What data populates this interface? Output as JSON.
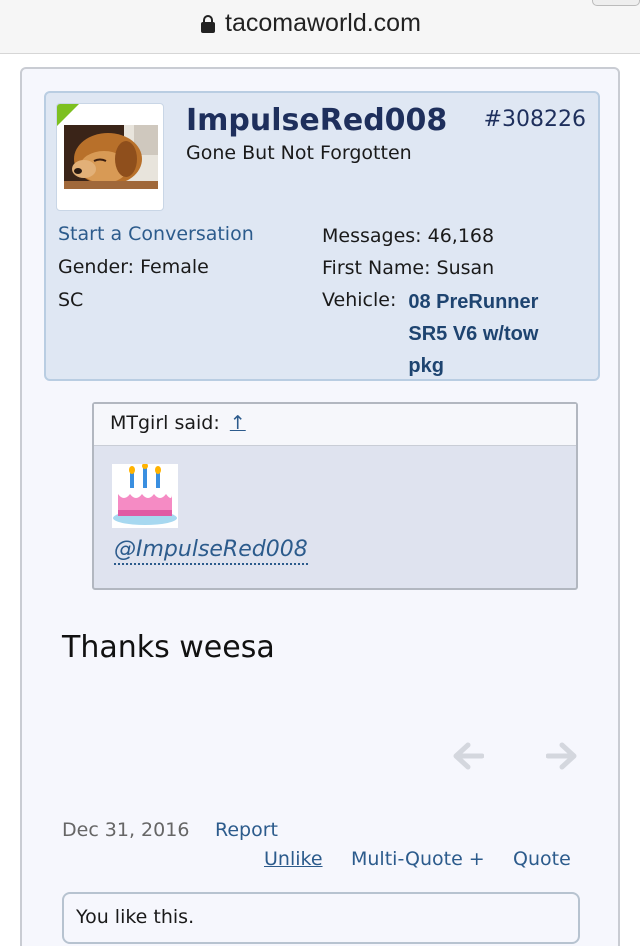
{
  "browser": {
    "domain": "tacomaworld.com"
  },
  "post": {
    "username": "ImpulseRed008",
    "post_number": "#308226",
    "user_title": "Gone But Not Forgotten",
    "start_conversation": "Start a Conversation",
    "gender_label": "Gender:",
    "gender": "Female",
    "location": "SC",
    "messages_label": "Messages:",
    "messages": "46,168",
    "first_name_label": "First Name:",
    "first_name": "Susan",
    "vehicle_label": "Vehicle:",
    "vehicle": "08 PreRunner SR5 V6 w/tow pkg",
    "quote": {
      "author": "MTgirl said:",
      "arrow": "↑",
      "mention": "@ImpulseRed008"
    },
    "message": "Thanks weesa",
    "date": "Dec 31, 2016",
    "report": "Report",
    "unlike": "Unlike",
    "multi_quote": "Multi-Quote +",
    "quote_label": "Quote",
    "likes_text": "You like this."
  },
  "icons": {
    "lock": "lock-icon",
    "prev": "arrow-left-icon",
    "next": "arrow-right-icon",
    "cake": "birthday-cake-icon"
  }
}
